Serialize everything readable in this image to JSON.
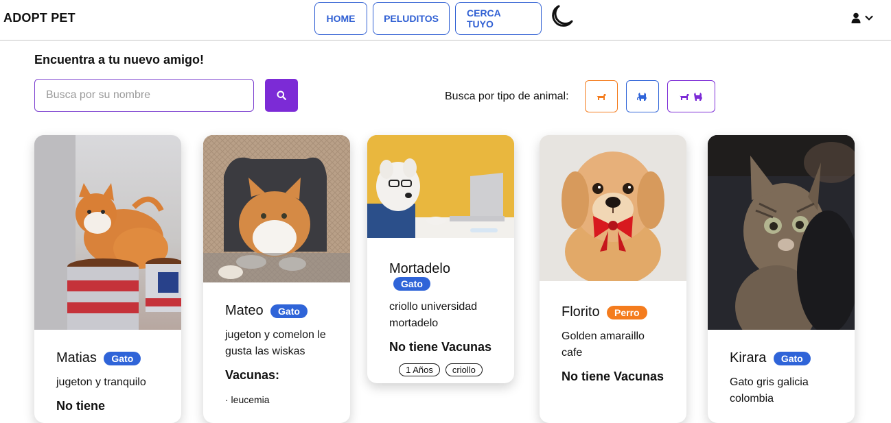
{
  "header": {
    "brand": "ADOPT PET",
    "nav": [
      "HOME",
      "PELUDITOS",
      "CERCA TUYO"
    ],
    "theme_icon": "moon-icon",
    "user_icon": "user-icon",
    "menu_icon": "chevron-down-icon"
  },
  "search": {
    "heading": "Encuentra a tu nuevo amigo!",
    "placeholder": "Busca por su nombre",
    "button_icon": "search-icon",
    "filter_label": "Busca por tipo de animal:",
    "filters": [
      {
        "icon": "dog-icon",
        "color": "#f47c1e"
      },
      {
        "icon": "cat-icon",
        "color": "#2f64d8"
      },
      {
        "icon": "dog-and-cat-icon",
        "color": "#7c2bd6"
      }
    ]
  },
  "pets": [
    {
      "name": "Matias",
      "type": "Gato",
      "description": "jugeton y tranquilo",
      "vaccines": "No tiene"
    },
    {
      "name": "Mateo",
      "type": "Gato",
      "description": "jugeton y comelon le gusta las wiskas",
      "vaccines": "Vacunas:",
      "vaccine_list": [
        "· leucemia"
      ]
    },
    {
      "name": "Mortadelo",
      "type": "Gato",
      "description": "criollo universidad mortadelo",
      "vaccines": "No tiene Vacunas",
      "tags": [
        "1 Años",
        "criollo"
      ]
    },
    {
      "name": "Florito",
      "type": "Perro",
      "description": "Golden amaraillo cafe",
      "vaccines": "No tiene Vacunas"
    },
    {
      "name": "Kirara",
      "type": "Gato",
      "description": "Gato gris galicia colombia"
    }
  ],
  "colors": {
    "accent": "#7c2bd6",
    "nav": "#2f5fd3",
    "gato": "#2f64d8",
    "perro": "#f47c1e"
  }
}
